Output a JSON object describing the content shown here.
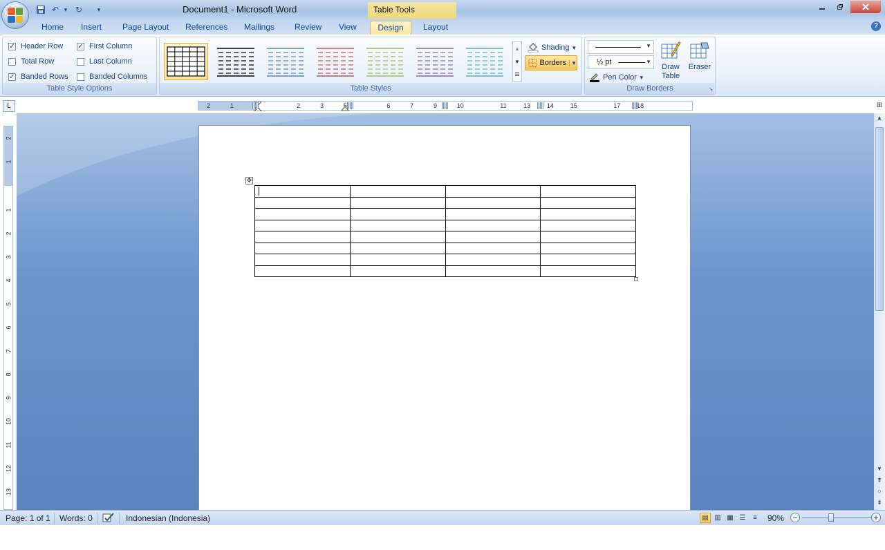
{
  "app": {
    "doc_title": "Document1 - Microsoft Word",
    "context_tab_label": "Table Tools",
    "qat": {
      "undo": "↶",
      "redo": "↻",
      "customize": "▾"
    }
  },
  "tabs": [
    {
      "label": "Home"
    },
    {
      "label": "Insert"
    },
    {
      "label": "Page Layout"
    },
    {
      "label": "References"
    },
    {
      "label": "Mailings"
    },
    {
      "label": "Review"
    },
    {
      "label": "View"
    },
    {
      "label": "Design",
      "active": true
    },
    {
      "label": "Layout"
    }
  ],
  "help": "?",
  "table_style_options": {
    "label": "Table Style Options",
    "header_row": {
      "label": "Header Row",
      "checked": true
    },
    "total_row": {
      "label": "Total Row",
      "checked": false
    },
    "banded_rows": {
      "label": "Banded Rows",
      "checked": true
    },
    "first_column": {
      "label": "First Column",
      "checked": true
    },
    "last_column": {
      "label": "Last Column",
      "checked": false
    },
    "banded_columns": {
      "label": "Banded Columns",
      "checked": false
    }
  },
  "table_styles": {
    "label": "Table Styles",
    "thumb_colors": [
      "#000000",
      "#000000",
      "#4f81bd",
      "#c0504d",
      "#9bbb59",
      "#8064a2",
      "#4bacc6"
    ],
    "shading_label": "Shading",
    "borders_label": "Borders"
  },
  "draw_borders": {
    "label": "Draw Borders",
    "line_weight": "½ pt",
    "pen_color_label": "Pen Color",
    "draw_table_label_1": "Draw",
    "draw_table_label_2": "Table",
    "eraser_label": "Eraser"
  },
  "ruler": {
    "h_ticks": [
      "2",
      "1",
      "1",
      "2",
      "3",
      "5",
      "6",
      "7",
      "9",
      "10",
      "11",
      "13",
      "14",
      "15",
      "17",
      "18"
    ],
    "v_ticks": [
      "2",
      "1",
      "1",
      "2",
      "3",
      "4",
      "5",
      "6",
      "7",
      "8",
      "9",
      "10",
      "11",
      "12",
      "13"
    ]
  },
  "document": {
    "table": {
      "rows": 8,
      "cols": 4
    }
  },
  "status": {
    "page": "Page: 1 of 1",
    "words": "Words: 0",
    "language": "Indonesian (Indonesia)",
    "zoom": "90%"
  }
}
